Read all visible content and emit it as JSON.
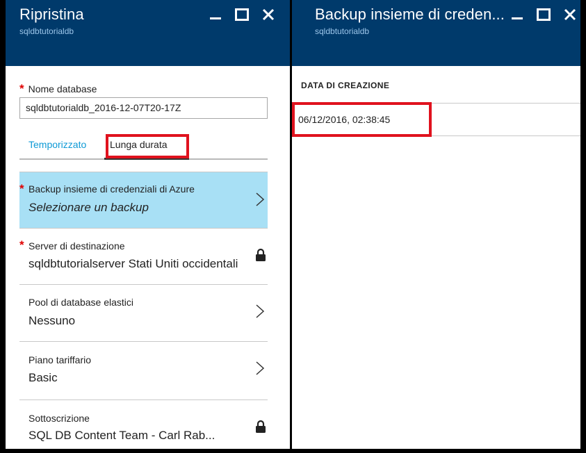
{
  "left_blade": {
    "title": "Ripristina",
    "subtitle": "sqldbtutorialdb",
    "db_name": {
      "required_mark": "*",
      "label": "Nome database",
      "value": "sqldbtutorialdb_2016-12-07T20-17Z"
    },
    "tabs": [
      {
        "label": "Temporizzato"
      },
      {
        "label": "Lunga durata"
      }
    ],
    "items": [
      {
        "required_mark": "*",
        "label": "Backup insieme di credenziali di Azure",
        "value": "Selezionare un backup"
      },
      {
        "required_mark": "*",
        "label": "Server di destinazione",
        "value": "sqldbtutorialserver Stati Uniti occidentali"
      },
      {
        "label": "Pool di database elastici",
        "value": "Nessuno"
      },
      {
        "label": "Piano tariffario",
        "value": "Basic"
      },
      {
        "label": "Sottoscrizione",
        "value": "SQL DB Content Team - Carl Rab..."
      }
    ]
  },
  "right_blade": {
    "title": "Backup insieme di creden...",
    "subtitle": "sqldbtutorialdb",
    "column_header": "DATA DI CREAZIONE",
    "rows": [
      {
        "date": "06/12/2016, 02:38:45"
      }
    ]
  },
  "colors": {
    "header_bg": "#003a6b",
    "selected_bg": "#a8e0f5",
    "highlight": "#e0121e",
    "tab_link": "#0e9ad6",
    "required": "#e00000"
  },
  "icons": [
    "minimize-icon",
    "maximize-icon",
    "close-icon",
    "chevron-right-icon",
    "lock-icon"
  ]
}
